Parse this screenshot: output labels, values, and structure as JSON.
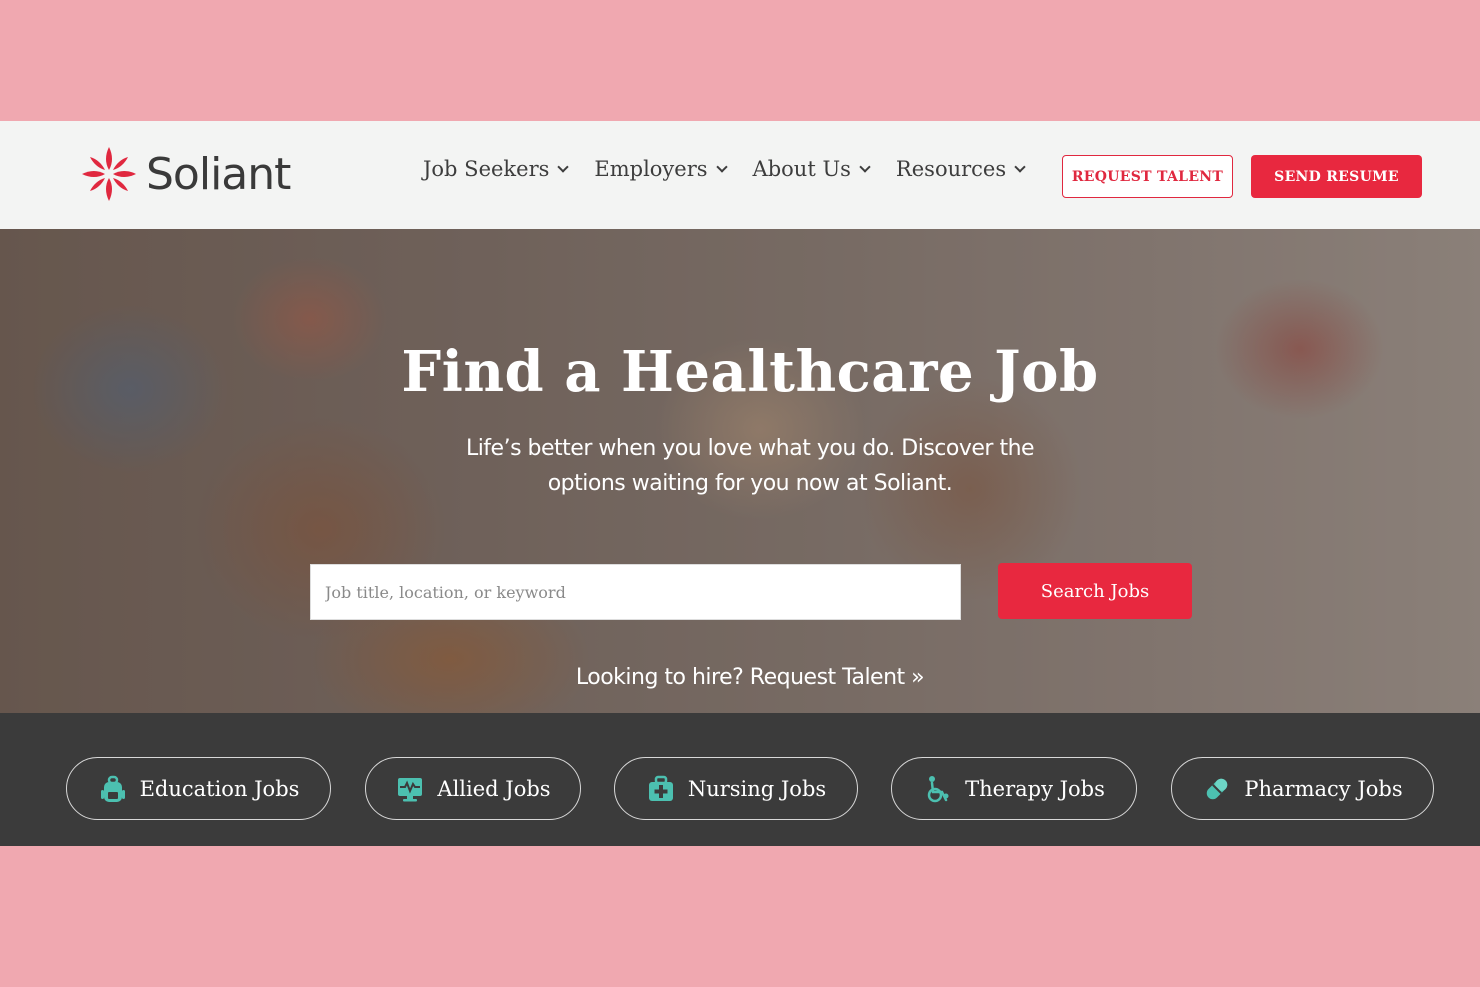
{
  "brand": {
    "name": "Soliant",
    "color": "#e0283f"
  },
  "nav": {
    "items": [
      {
        "label": "Job Seekers"
      },
      {
        "label": "Employers"
      },
      {
        "label": "About Us"
      },
      {
        "label": "Resources"
      }
    ],
    "request_talent": "REQUEST TALENT",
    "send_resume": "SEND RESUME"
  },
  "hero": {
    "title": "Find a Healthcare Job",
    "subtitle": "Life’s better when you love what you do. Discover the options waiting for you now at Soliant.",
    "search_placeholder": "Job title, location, or keyword",
    "search_button": "Search Jobs",
    "hire_link": "Looking to hire? Request Talent »"
  },
  "categories": [
    {
      "label": "Education Jobs",
      "icon": "backpack-icon"
    },
    {
      "label": "Allied Jobs",
      "icon": "heart-monitor-icon"
    },
    {
      "label": "Nursing Jobs",
      "icon": "medical-kit-icon"
    },
    {
      "label": "Therapy Jobs",
      "icon": "wheelchair-icon"
    },
    {
      "label": "Pharmacy Jobs",
      "icon": "pill-icon"
    }
  ],
  "colors": {
    "accent": "#e8283f",
    "icon": "#4cc0b0",
    "bar": "#3b3b3b",
    "backdrop": "#f0a8b0"
  }
}
